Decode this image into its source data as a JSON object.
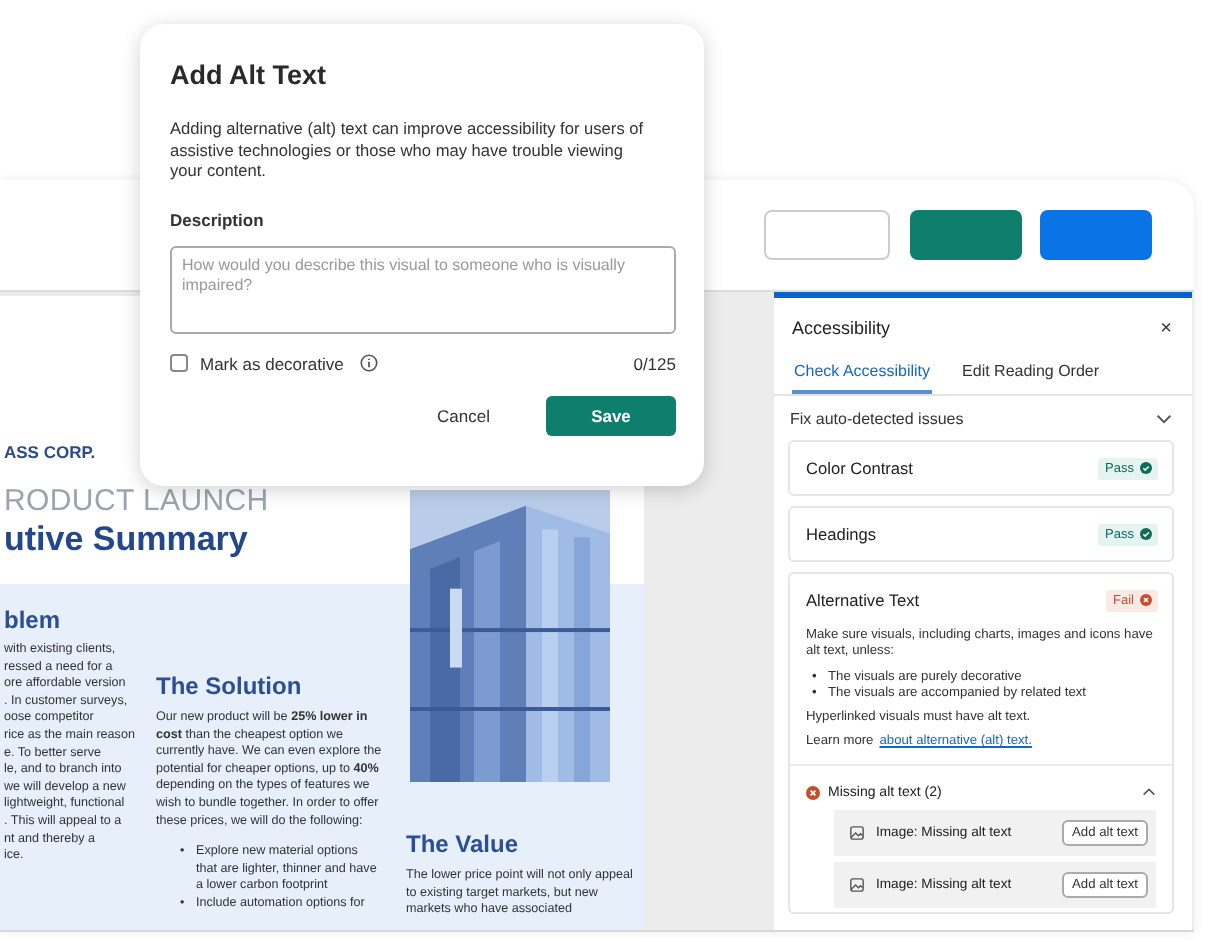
{
  "toolbar": {
    "buttons": [
      {
        "kind": "outline"
      },
      {
        "kind": "teal"
      },
      {
        "kind": "blue"
      }
    ]
  },
  "document": {
    "company": "ASS CORP.",
    "kicker": "RODUCT LAUNCH",
    "title": "utive Summary",
    "columns": [
      {
        "heading": "blem",
        "lines": [
          "with existing clients,",
          "ressed a need for a",
          "ore affordable version",
          ". In customer surveys,",
          "oose competitor",
          "rice as the main reason",
          "e. To better serve",
          "le, and to branch into",
          "we will develop a new",
          "lightweight, functional",
          ". This will appeal to a",
          "nt and thereby a",
          "ice."
        ]
      },
      {
        "heading": "The Solution",
        "bullet_marker": "•",
        "paragraph": "Our new product will be **25% lower in cost** than the cheapest option we currently have. We can even explore the potential for cheaper options, up to **40%** depending on the types of features we wish to bundle together. In order to offer these prices, we will do the following:",
        "bullets": [
          "Explore new material options that are lighter, thinner and have a lower carbon footprint",
          "Include automation options for"
        ]
      },
      {
        "heading": "The Value",
        "paragraph": "The lower price point will not only appeal to existing target markets, but new markets who have associated"
      }
    ]
  },
  "panel": {
    "title": "Accessibility",
    "close": "×",
    "tabs": [
      {
        "label": "Check Accessibility",
        "selected": true
      },
      {
        "label": "Edit Reading Order",
        "selected": false
      }
    ],
    "section": {
      "label": "Fix auto-detected issues",
      "expanded": true
    },
    "checks": [
      {
        "title": "Color Contrast",
        "status": "Pass",
        "kind": "pass"
      },
      {
        "title": "Headings",
        "status": "Pass",
        "kind": "pass"
      },
      {
        "title": "Alternative Text",
        "status": "Fail",
        "kind": "fail",
        "bullet_marker": "•",
        "intro": "Make sure visuals, including charts, images and icons have alt text, unless:",
        "bullets": [
          "The visuals are purely decorative",
          "The visuals are accompanied by related text"
        ],
        "note": "Hyperlinked visuals must have alt text.",
        "learn_more": "Learn more",
        "link": "about alternative (alt) text.",
        "issues": {
          "label": "Missing alt text (2)",
          "expanded": true,
          "items": [
            {
              "label": "Image: Missing alt text",
              "action": "Add alt text"
            },
            {
              "label": "Image: Missing alt text",
              "action": "Add alt text"
            }
          ]
        }
      }
    ]
  },
  "dialog": {
    "title": "Add Alt Text",
    "body": "Adding alternative (alt) text can improve accessibility for users of assistive technologies or those who may have trouble viewing your content.",
    "field_label": "Description",
    "field": {
      "placeholder": "How would you describe this visual to someone who is visually impaired?"
    },
    "decorative": {
      "label": "Mark as decorative",
      "checked": false
    },
    "counter": "0/125",
    "buttons": [
      {
        "label": "Cancel",
        "kind": "text"
      },
      {
        "label": "Save",
        "kind": "primary"
      }
    ]
  }
}
